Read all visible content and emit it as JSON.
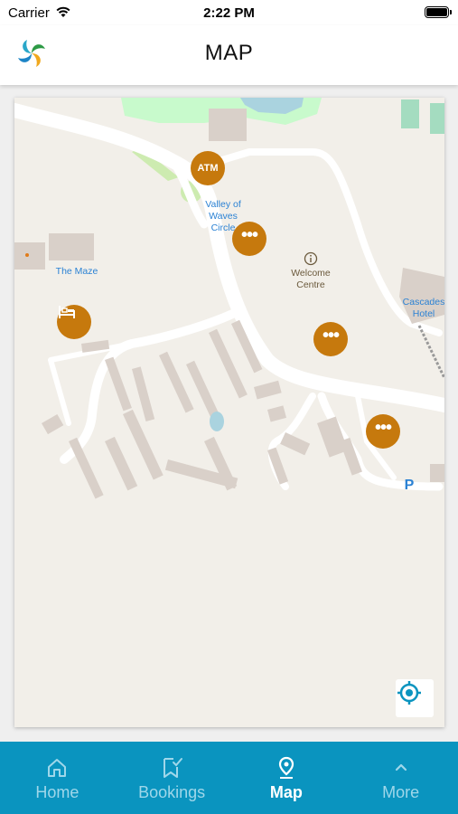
{
  "status_bar": {
    "carrier": "Carrier",
    "time": "2:22 PM"
  },
  "header": {
    "title": "MAP"
  },
  "map": {
    "labels": {
      "valley_of_waves": "Valley of\nWaves\nCircle",
      "the_maze": "The Maze",
      "welcome_centre": "Welcome\nCentre",
      "cascades_hotel": "Cascades\nHotel",
      "parking": "P"
    },
    "markers": [
      {
        "type": "atm",
        "label": "ATM"
      },
      {
        "type": "more",
        "label": "•••"
      },
      {
        "type": "more",
        "label": "•••"
      },
      {
        "type": "more",
        "label": "•••"
      },
      {
        "type": "hotel",
        "label": ""
      }
    ],
    "colors": {
      "marker": "#c6790d",
      "land": "#f2efe9",
      "road": "#ffffff",
      "building": "#d9d0c9",
      "water": "#aad3df",
      "park": "#c8facc"
    }
  },
  "tabs": [
    {
      "label": "Home",
      "icon": "home-icon",
      "active": false
    },
    {
      "label": "Bookings",
      "icon": "bookmark-check-icon",
      "active": false
    },
    {
      "label": "Map",
      "icon": "map-pin-icon",
      "active": true
    },
    {
      "label": "More",
      "icon": "chevron-up-icon",
      "active": false
    }
  ],
  "accent_color": "#0a94bf"
}
